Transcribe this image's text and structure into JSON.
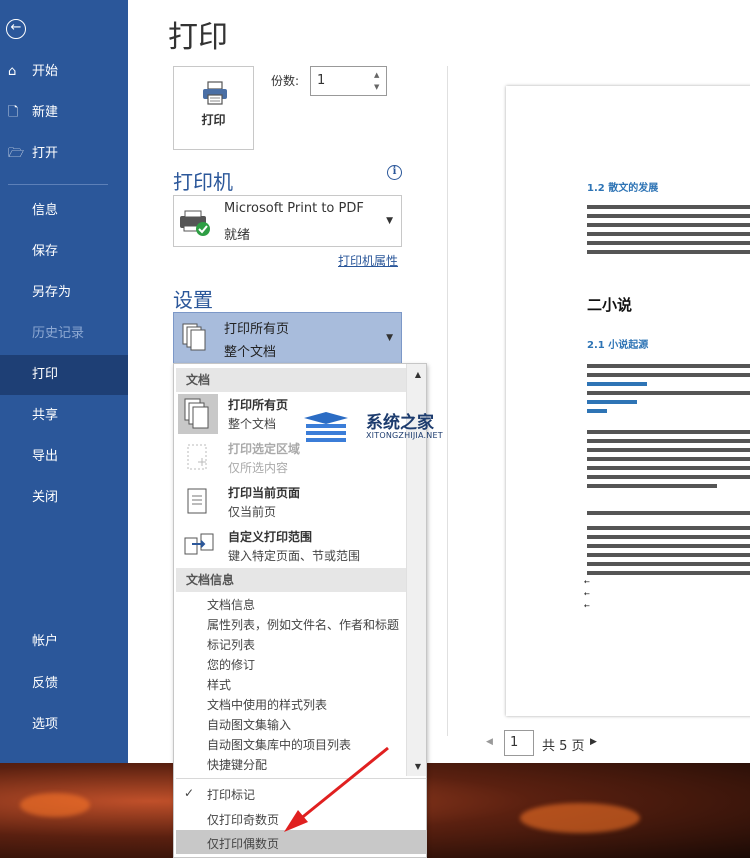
{
  "nav": {
    "back_icon": "back-arrow-icon",
    "items": [
      {
        "label": "开始",
        "icon": "home-icon"
      },
      {
        "label": "新建",
        "icon": "new-doc-icon"
      },
      {
        "label": "打开",
        "icon": "folder-open-icon"
      },
      {
        "label": "信息"
      },
      {
        "label": "保存"
      },
      {
        "label": "另存为"
      },
      {
        "label": "历史记录"
      },
      {
        "label": "打印"
      },
      {
        "label": "共享"
      },
      {
        "label": "导出"
      },
      {
        "label": "关闭"
      },
      {
        "label": "帐户"
      },
      {
        "label": "反馈"
      },
      {
        "label": "选项"
      }
    ],
    "active": "打印",
    "colors": {
      "bg": "#2b579a",
      "active": "#1e3f75"
    }
  },
  "main": {
    "title": "打印",
    "print_button": "打印",
    "copies_label": "份数:",
    "copies_value": "1",
    "printer_heading": "打印机",
    "printer_name": "Microsoft Print to PDF",
    "printer_status": "就绪",
    "printer_properties": "打印机属性",
    "settings_heading": "设置",
    "setting_title": "打印所有页",
    "setting_sub": "整个文档"
  },
  "dropdown": {
    "section_doc": "文档",
    "options": [
      {
        "title": "打印所有页",
        "sub": "整个文档"
      },
      {
        "title": "打印选定区域",
        "sub": "仅所选内容"
      },
      {
        "title": "打印当前页面",
        "sub": "仅当前页"
      },
      {
        "title": "自定义打印范围",
        "sub": "键入特定页面、节或范围"
      }
    ],
    "section_info": "文档信息",
    "info_items": [
      "文档信息",
      "属性列表，例如文件名、作者和标题",
      "标记列表",
      "您的修订",
      "样式",
      "文档中使用的样式列表",
      "自动图文集输入",
      "自动图文集库中的项目列表",
      "快捷键分配"
    ],
    "check_items": [
      "打印标记",
      "仅打印奇数页",
      "仅打印偶数页"
    ],
    "checked": "打印标记",
    "highlighted": "仅打印偶数页"
  },
  "preview": {
    "heading_12": "1.2 散文的发展",
    "heading_ch2": "二小说",
    "heading_21": "2.1 小说起源",
    "page_current": "1",
    "page_total": "共 5 页"
  },
  "watermark": {
    "cn": "系统之家",
    "en": "XITONGZHIJIA.NET"
  }
}
